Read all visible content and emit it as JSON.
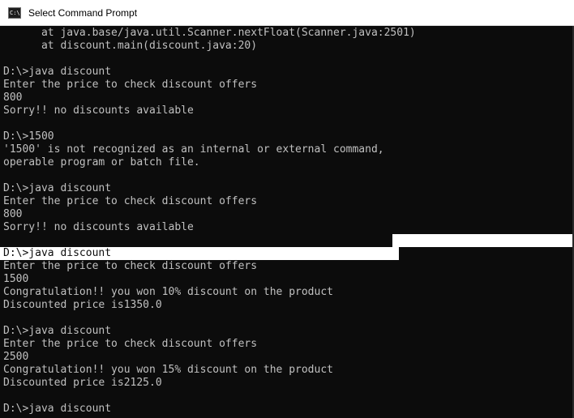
{
  "window": {
    "title": "Select Command Prompt",
    "icon": "command-prompt-icon",
    "icon_glyph": "C:\\"
  },
  "console": {
    "lines": [
      "      at java.base/java.util.Scanner.nextFloat(Scanner.java:2501)",
      "      at discount.main(discount.java:20)",
      "",
      "D:\\>java discount",
      "Enter the price to check discount offers",
      "800",
      "Sorry!! no discounts available",
      "",
      "D:\\>1500",
      "'1500' is not recognized as an internal or external command,",
      "operable program or batch file.",
      "",
      "D:\\>java discount",
      "Enter the price to check discount offers",
      "800",
      "Sorry!! no discounts available",
      "",
      "D:\\>java discount",
      "Enter the price to check discount offers",
      "1500",
      "Congratulation!! you won 10% discount on the product",
      "Discounted price is1350.0",
      "",
      "D:\\>java discount",
      "Enter the price to check discount offers",
      "2500",
      "Congratulation!! you won 15% discount on the product",
      "Discounted price is2125.0",
      "",
      "D:\\>java discount"
    ],
    "selected_line": 17,
    "colors": {
      "background": "#0c0c0c",
      "text": "#c0c0c0",
      "selection": "#ffffff"
    }
  }
}
